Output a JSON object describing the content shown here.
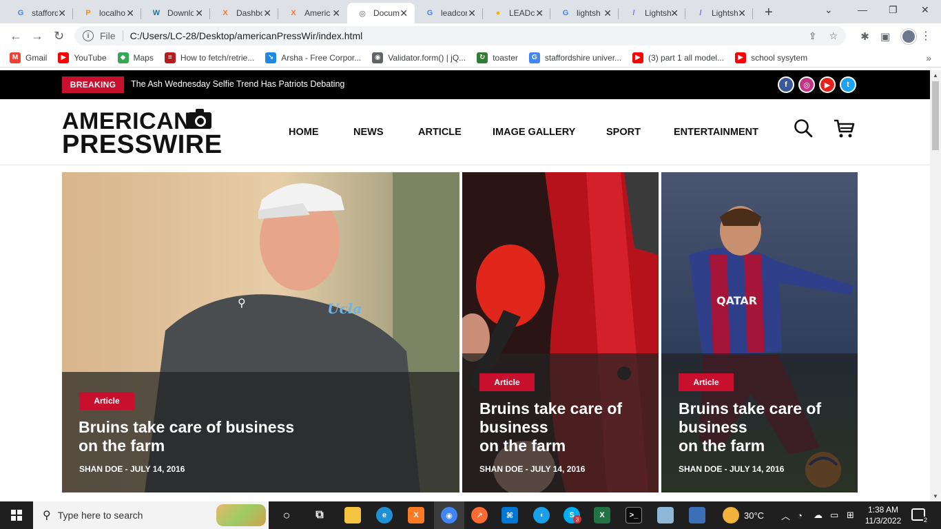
{
  "browser": {
    "tabs": [
      {
        "label": "stafford",
        "favicon": "G",
        "fav_color": "#4285f4"
      },
      {
        "label": "localhost",
        "favicon": "P",
        "fav_color": "#f29111"
      },
      {
        "label": "Download",
        "favicon": "W",
        "fav_color": "#21759b"
      },
      {
        "label": "Dashboard",
        "favicon": "X",
        "fav_color": "#fb7a24"
      },
      {
        "label": "American",
        "favicon": "X",
        "fav_color": "#fb7a24"
      },
      {
        "label": "Document",
        "favicon": "◎",
        "fav_color": "#5f6368"
      },
      {
        "label": "leadcon",
        "favicon": "G",
        "fav_color": "#4285f4"
      },
      {
        "label": "LEADcon",
        "favicon": "●",
        "fav_color": "#f4b400"
      },
      {
        "label": "lightsh",
        "favicon": "G",
        "fav_color": "#4285f4"
      },
      {
        "label": "Lightsh",
        "favicon": "/",
        "fav_color": "#8b5cf6"
      },
      {
        "label": "Lightsh",
        "favicon": "/",
        "fav_color": "#8b5cf6"
      }
    ],
    "active_tab_index": 5,
    "address": {
      "scheme_label": "File",
      "url": "C:/Users/LC-28/Desktop/americanPressWir/index.html"
    },
    "bookmarks": [
      {
        "label": "Gmail",
        "icon": "gmail-icon",
        "color": "#ea4335",
        "glyph": "M"
      },
      {
        "label": "YouTube",
        "icon": "youtube-icon",
        "color": "#ff0000",
        "glyph": "▶"
      },
      {
        "label": "Maps",
        "icon": "maps-icon",
        "color": "#34a853",
        "glyph": "◆"
      },
      {
        "label": "How to fetch/retrie...",
        "icon": "site-icon",
        "color": "#b71c1c",
        "glyph": "≡"
      },
      {
        "label": "Arsha - Free Corpor...",
        "icon": "arsha-icon",
        "color": "#1e88e5",
        "glyph": "↘"
      },
      {
        "label": "Validator.form() | jQ...",
        "icon": "globe-icon",
        "color": "#5f6368",
        "glyph": "◉"
      },
      {
        "label": "toaster",
        "icon": "toaster-icon",
        "color": "#2e7d32",
        "glyph": "↻"
      },
      {
        "label": "staffordshire univer...",
        "icon": "google-icon",
        "color": "#4285f4",
        "glyph": "G"
      },
      {
        "label": "(3) part 1 all model...",
        "icon": "youtube-icon",
        "color": "#ff0000",
        "glyph": "▶"
      },
      {
        "label": "school sysytem",
        "icon": "youtube-icon",
        "color": "#ff0000",
        "glyph": "▶"
      }
    ]
  },
  "site": {
    "breaking": {
      "tag": "BREAKING",
      "headline": "The Ash Wednesday Selfie Trend Has Patriots Debating"
    },
    "social": [
      {
        "name": "facebook-icon",
        "glyph": "f",
        "color": "#3b5998"
      },
      {
        "name": "instagram-icon",
        "glyph": "◎",
        "color": "#c13584"
      },
      {
        "name": "youtube-icon",
        "glyph": "▶",
        "color": "#e62117"
      },
      {
        "name": "twitter-icon",
        "glyph": "t",
        "color": "#1da1f2"
      }
    ],
    "logo": {
      "line1": "AMERICAN",
      "line2": "PRESSWIRE"
    },
    "nav": [
      "HOME",
      "NEWS",
      "ARTICLE",
      "IMAGE GALLERY",
      "SPORT",
      "ENTERTAINMENT"
    ],
    "cards": [
      {
        "category": "Article",
        "title": "Bruins take care of business\non the farm",
        "meta": "SHAN DOE - JULY 14, 2016"
      },
      {
        "category": "Article",
        "title": "Bruins take care of\nbusiness\non the farm",
        "meta": "SHAN DOE - JULY 14, 2016"
      },
      {
        "category": "Article",
        "title": "Bruins take care of\nbusiness\non the farm",
        "meta": "SHAN DOE - JULY 14, 2016"
      }
    ]
  },
  "taskbar": {
    "search_placeholder": "Type here to search",
    "weather": "30°C",
    "time": "1:38 AM",
    "date": "11/3/2022",
    "notification_count": "2",
    "skype_badge": "3"
  },
  "colors": {
    "accent": "#c8102e",
    "topbar": "#000000"
  }
}
